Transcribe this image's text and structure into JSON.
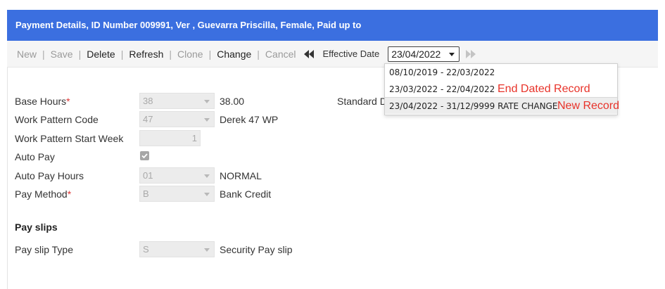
{
  "header": {
    "title": "Payment Details, ID Number 009991, Ver , Guevarra Priscilla, Female, Paid up to"
  },
  "toolbar": {
    "new": "New",
    "save": "Save",
    "delete": "Delete",
    "refresh": "Refresh",
    "clone": "Clone",
    "change": "Change",
    "cancel": "Cancel",
    "effective_date_label": "Effective Date",
    "effective_date_value": "23/04/2022"
  },
  "dropdown": {
    "items": [
      {
        "label": "08/10/2019 - 22/03/2022",
        "annotation": ""
      },
      {
        "label": "23/03/2022 - 22/04/2022",
        "annotation": "End Dated Record"
      },
      {
        "label": "23/04/2022 - 31/12/9999 RATE CHANGE",
        "annotation": "New Record"
      }
    ]
  },
  "form": {
    "base_hours": {
      "label": "Base Hours",
      "value": "38",
      "desc": "38.00"
    },
    "work_pattern_code": {
      "label": "Work Pattern Code",
      "value": "47",
      "desc": "Derek 47 WP"
    },
    "work_pattern_start_week": {
      "label": "Work Pattern Start Week",
      "value": "1"
    },
    "auto_pay": {
      "label": "Auto Pay",
      "checked": true
    },
    "auto_pay_hours": {
      "label": "Auto Pay Hours",
      "value": "01",
      "desc": "NORMAL"
    },
    "pay_method": {
      "label": "Pay Method",
      "value": "B",
      "desc": "Bank Credit"
    },
    "standard_label": "Standard D",
    "required_mark": "*"
  },
  "payslips": {
    "section_title": "Pay slips",
    "type": {
      "label": "Pay slip Type",
      "value": "S",
      "desc": "Security Pay slip"
    }
  },
  "colors": {
    "header": "#3b6fe0",
    "annotation": "#e8332a"
  }
}
